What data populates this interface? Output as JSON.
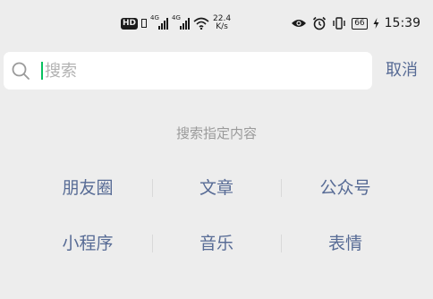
{
  "status_bar": {
    "hd_badge": "HD",
    "signal_1": "4G",
    "signal_2": "4G",
    "net_speed_value": "22.4",
    "net_speed_unit": "K/s",
    "battery": "66",
    "time": "15:39",
    "icons": [
      "hd-icon",
      "signal-icon",
      "signal-icon",
      "wifi-icon",
      "eye-icon",
      "alarm-icon",
      "vibrate-icon",
      "battery-icon",
      "charging-icon"
    ]
  },
  "search": {
    "placeholder": "搜索",
    "value": "",
    "cancel_label": "取消"
  },
  "hint": "搜索指定内容",
  "categories": [
    [
      "朋友圈",
      "文章",
      "公众号"
    ],
    [
      "小程序",
      "音乐",
      "表情"
    ]
  ],
  "colors": {
    "background": "#ededed",
    "link": "#576b95",
    "hint": "#9a9a9a",
    "caret": "#07c160"
  }
}
